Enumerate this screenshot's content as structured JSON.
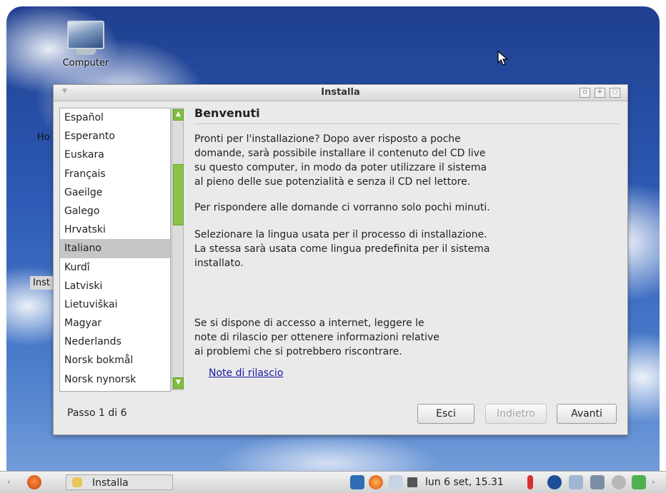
{
  "desktop": {
    "computer_icon_label": "Computer",
    "fragment_home": "Ho",
    "fragment_install": "Inst"
  },
  "window": {
    "title": "Installa",
    "buttons": [
      "restore-icon",
      "maximize-icon",
      "power-icon"
    ]
  },
  "languages": {
    "items": [
      "Español",
      "Esperanto",
      "Euskara",
      "Français",
      "Gaeilge",
      "Galego",
      "Hrvatski",
      "Italiano",
      "Kurdî",
      "Latviski",
      "Lietuviškai",
      "Magyar",
      "Nederlands",
      "Norsk bokmål",
      "Norsk nynorsk"
    ],
    "selected": "Italiano"
  },
  "content": {
    "heading": "Benvenuti",
    "para1": "Pronti per l'installazione? Dopo aver risposto a poche\ndomande, sarà possibile installare il contenuto del CD live\nsu questo computer, in modo da poter utilizzare il sistema\nal pieno delle sue potenzialità e senza il CD nel lettore.",
    "para2": "Per rispondere alle domande ci vorranno solo pochi minuti.",
    "para3": "Selezionare la lingua usata per il processo di installazione.\nLa stessa sarà usata come lingua predefinita per il sistema\ninstallato.",
    "para4": "Se si dispone di accesso a internet, leggere le\nnote di rilascio per ottenere informazioni relative\nai problemi che si potrebbero riscontrare.",
    "link": "Note di rilascio"
  },
  "footer": {
    "step": "Passo 1 di 6",
    "quit": "Esci",
    "back": "Indietro",
    "forward": "Avanti"
  },
  "taskbar": {
    "task_label": "Installa",
    "clock": "lun  6 set, 15.31"
  }
}
